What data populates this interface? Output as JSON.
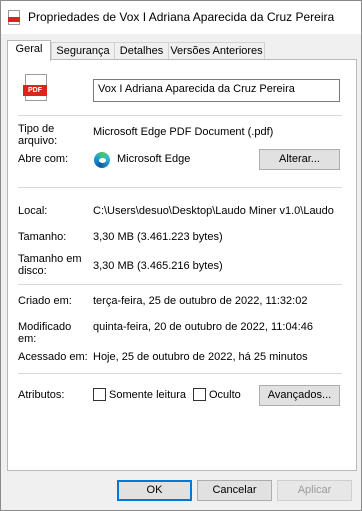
{
  "window": {
    "title": "Propriedades de Vox I Adriana Aparecida da Cruz Pereira",
    "icon": "pdf-file-icon"
  },
  "tabs": [
    {
      "label": "Geral",
      "active": true
    },
    {
      "label": "Segurança",
      "active": false
    },
    {
      "label": "Detalhes",
      "active": false
    },
    {
      "label": "Versões Anteriores",
      "active": false
    }
  ],
  "general": {
    "file_icon_text": "PDF",
    "file_name": "Vox I Adriana Aparecida da Cruz Pereira",
    "type_label": "Tipo de arquivo:",
    "type_value": "Microsoft Edge PDF Document (.pdf)",
    "opens_with_label": "Abre com:",
    "opens_with_value": "Microsoft Edge",
    "change_button": "Alterar...",
    "location_label": "Local:",
    "location_value": "C:\\Users\\desuo\\Desktop\\Laudo Miner v1.0\\Laudo",
    "size_label": "Tamanho:",
    "size_value": "3,30 MB (3.461.223 bytes)",
    "size_on_disk_label": "Tamanho em disco:",
    "size_on_disk_value": "3,30 MB (3.465.216 bytes)",
    "created_label": "Criado em:",
    "created_value": "terça-feira, 25 de outubro de 2022, 11:32:02",
    "modified_label": "Modificado em:",
    "modified_value": "quinta-feira, 20 de outubro de 2022, 11:04:46",
    "accessed_label": "Acessado em:",
    "accessed_value": "Hoje, 25 de outubro de 2022, há 25 minutos",
    "attributes_label": "Atributos:",
    "readonly_label": "Somente leitura",
    "readonly_checked": false,
    "hidden_label": "Oculto",
    "hidden_checked": false,
    "advanced_button": "Avançados..."
  },
  "footer": {
    "ok": "OK",
    "cancel": "Cancelar",
    "apply": "Aplicar"
  },
  "colors": {
    "pdf_red": "#d9251c",
    "default_button_border": "#0078d7"
  }
}
